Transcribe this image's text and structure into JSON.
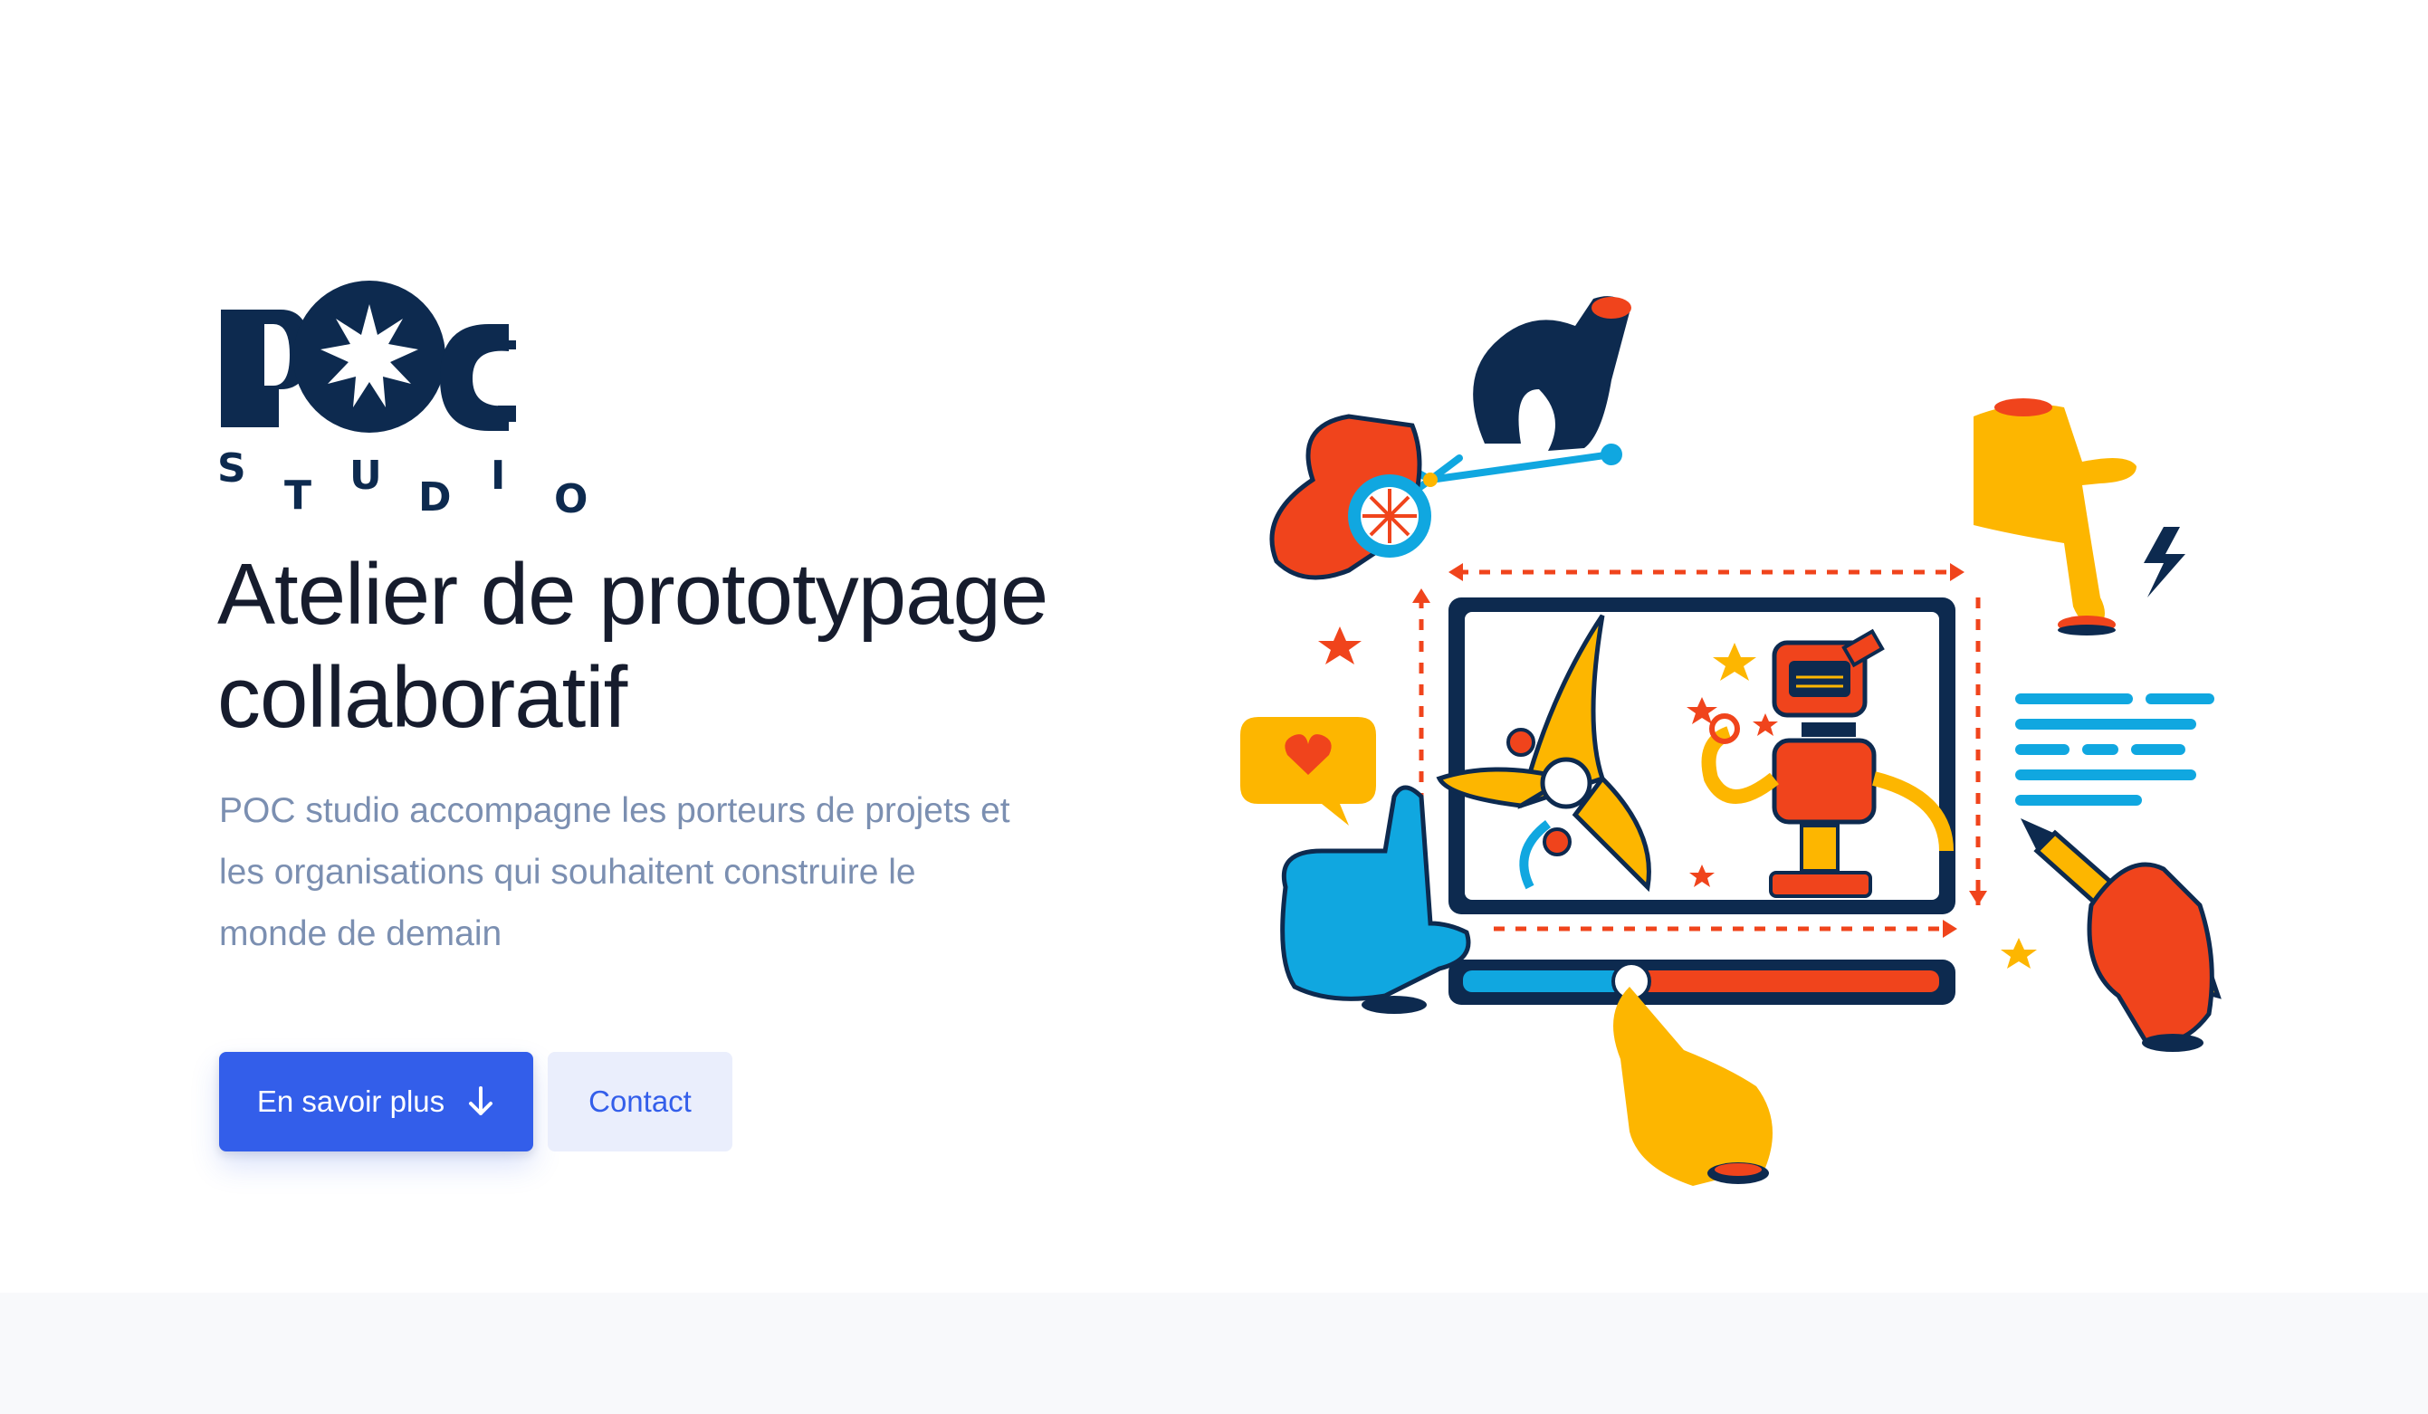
{
  "brand": {
    "logo_text": "POC",
    "logo_subtext": "STUDIO",
    "colors": {
      "navy": "#0d2a4f",
      "primary": "#335eea",
      "red": "#f0441c",
      "yellow": "#fdb600",
      "cyan": "#10a7e0"
    }
  },
  "hero": {
    "title_line1": "Atelier de prototypage",
    "title_line2": "collaboratif",
    "lead_line1": "POC studio accompagne les porteurs de projets et",
    "lead_line2": "les organisations qui souhaitent construire le",
    "lead_line3": "monde de demain",
    "primary_button": {
      "label": "En savoir plus",
      "icon": "arrow-down-icon"
    },
    "secondary_button": {
      "label": "Contact"
    }
  },
  "illustration": {
    "subject": "prototyping-workspace-illustration",
    "icons": [
      "hand-pointer-icon",
      "robot-icon",
      "heart-bubble-icon",
      "lightning-icon",
      "pencil-icon",
      "star-icon",
      "text-lines-icon",
      "progress-slider-icon"
    ]
  }
}
